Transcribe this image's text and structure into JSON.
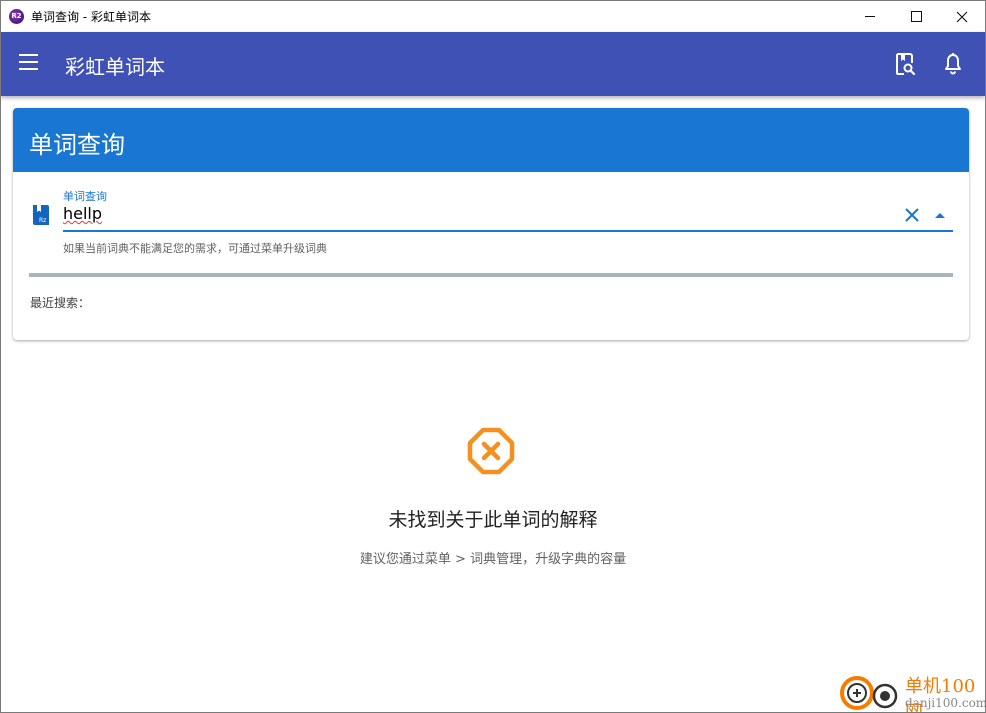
{
  "window": {
    "title": "单词查询 - 彩虹单词本",
    "icon_label": "R2"
  },
  "appbar": {
    "title": "彩虹单词本",
    "icons": [
      "menu-icon",
      "dictionary-search-icon",
      "bell-icon"
    ]
  },
  "card": {
    "title": "单词查询",
    "field": {
      "label": "单词查询",
      "value": "hellp",
      "hint": "如果当前词典不能满足您的需求，可通过菜单升级词典",
      "icon_label": "Rz"
    },
    "recent_label": "最近搜索："
  },
  "empty_state": {
    "title": "未找到关于此单词的解释",
    "subtitle": "建议您通过菜单 > 词典管理，升级字典的容量"
  },
  "watermark": {
    "line1": "单机100网",
    "line2": "danji100.com"
  },
  "colors": {
    "appbar": "#3f51b5",
    "card_header": "#1976d2",
    "accent_orange": "#f5901e",
    "progress": "#a9b5bd"
  }
}
